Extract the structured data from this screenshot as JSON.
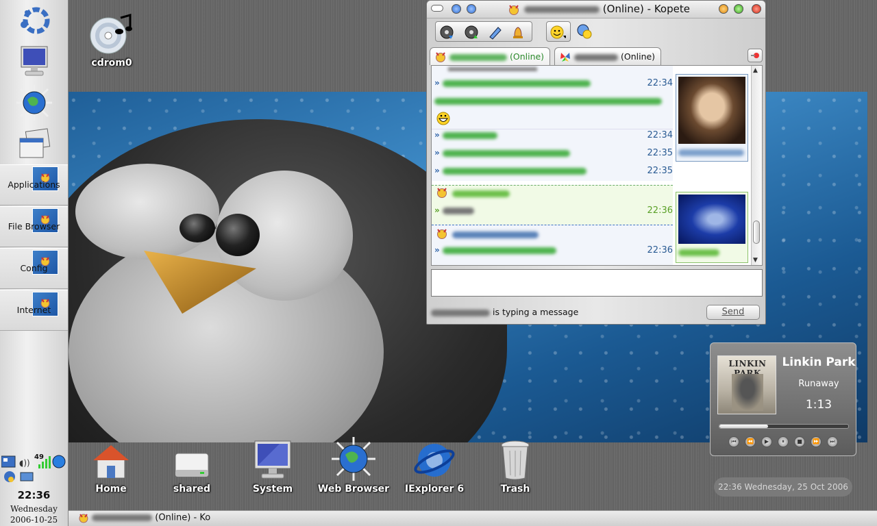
{
  "desktop": {
    "top_icon": {
      "label": "cdrom0"
    },
    "icons": [
      {
        "label": "Home",
        "icon": "home-icon"
      },
      {
        "label": "shared",
        "icon": "drive-icon"
      },
      {
        "label": "System",
        "icon": "monitor-icon"
      },
      {
        "label": "Web Browser",
        "icon": "globe-icon"
      },
      {
        "label": "IExplorer 6",
        "icon": "ie-icon"
      },
      {
        "label": "Trash",
        "icon": "trash-icon"
      }
    ]
  },
  "left_panel": {
    "buttons": [
      {
        "label": "Applications"
      },
      {
        "label": "File Browser"
      },
      {
        "label": "Config"
      },
      {
        "label": "Internet"
      }
    ],
    "tray": {
      "signal_value": "49"
    },
    "clock": {
      "time": "22:36",
      "day": "Wednesday",
      "date": "2006-10-25"
    }
  },
  "kopete": {
    "title_suffix": "(Online) - Kopete",
    "tabs": [
      {
        "status": "(Online)"
      },
      {
        "status": "(Online)"
      }
    ],
    "messages": [
      {
        "time": "22:34"
      },
      {
        "time": "22:34"
      },
      {
        "time": "22:35"
      },
      {
        "time": "22:35"
      },
      {
        "time": "22:36"
      },
      {
        "time": "22:36"
      }
    ],
    "status_text": "is typing a message",
    "send_label": "Send"
  },
  "player": {
    "artist": "Linkin Park",
    "track": "Runaway",
    "time": "1:13",
    "progress": 0.38,
    "album_text": "LINKIN PARK"
  },
  "desk_clock": {
    "text": "22:36  Wednesday, 25 Oct 2006"
  },
  "taskbar": {
    "item_suffix": "(Online) - Ko"
  },
  "colors": {
    "wallpaper_blue": "#2f7bbd",
    "message_time": "#2a5b93",
    "online_green": "#2c8a2c"
  }
}
